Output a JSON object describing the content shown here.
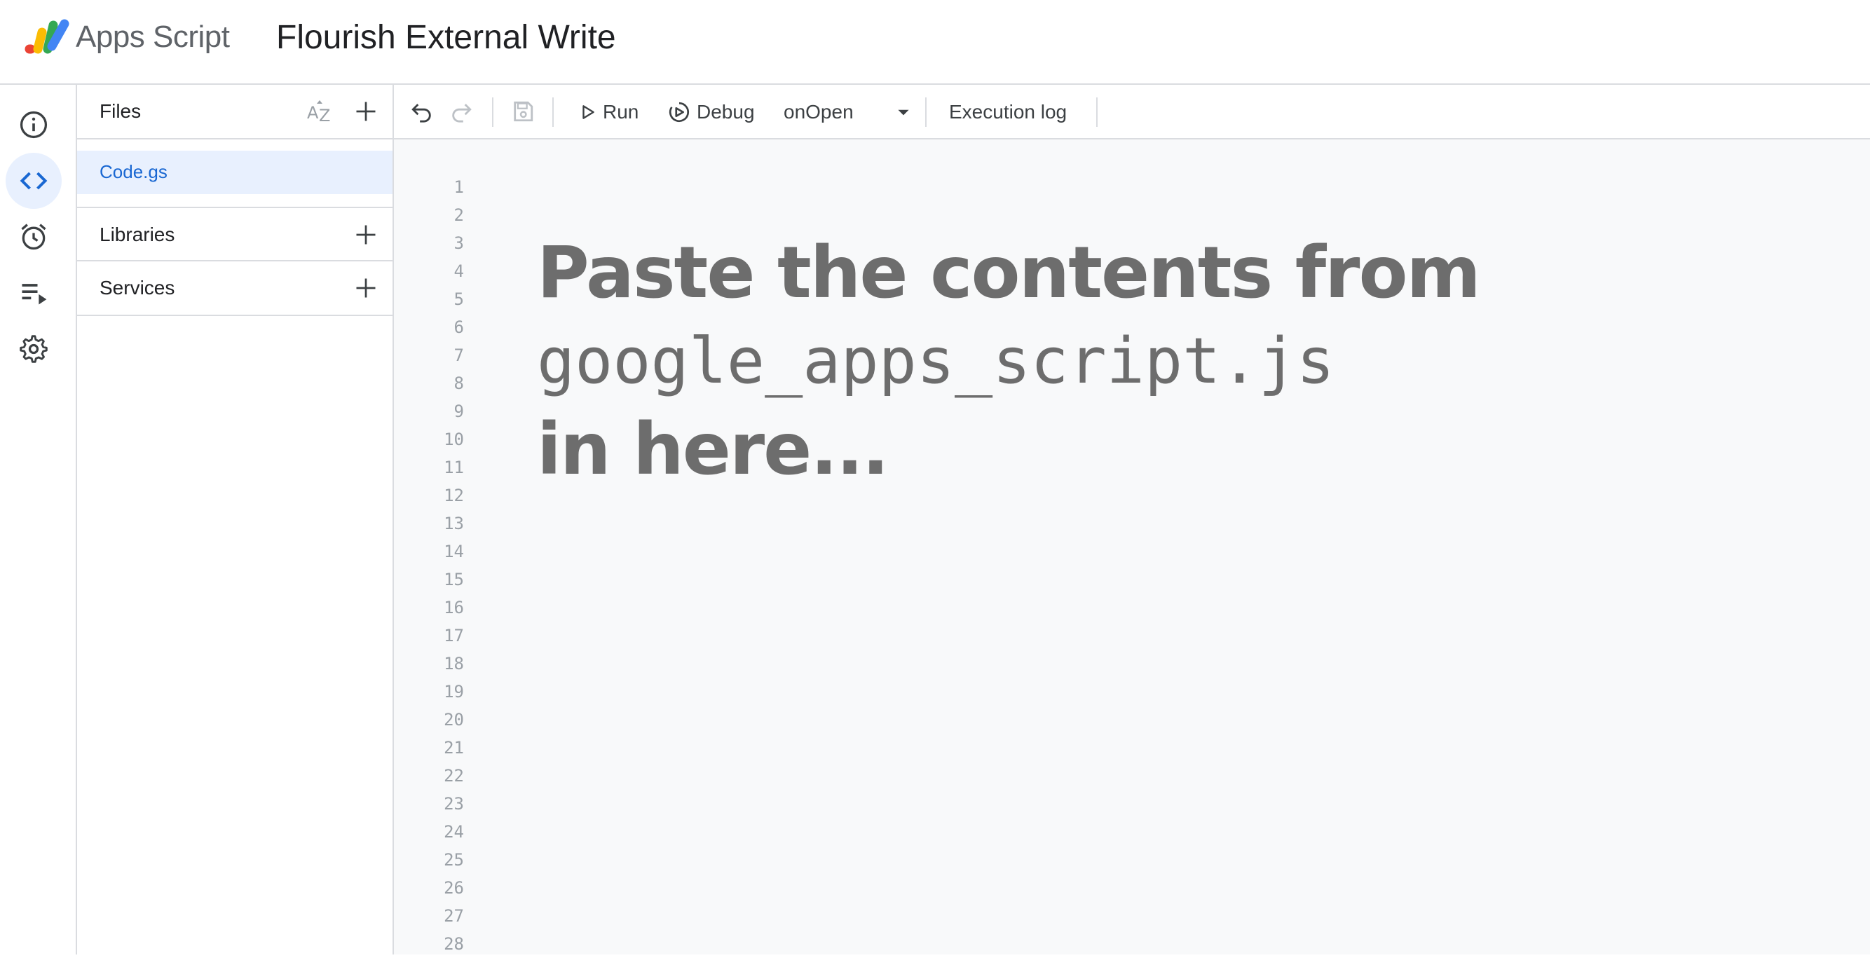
{
  "app": {
    "product_name": "Apps Script",
    "project_title": "Flourish External Write"
  },
  "rail": {
    "items": [
      {
        "name": "overview",
        "icon": "info-icon"
      },
      {
        "name": "editor",
        "icon": "code-icon",
        "active": true
      },
      {
        "name": "triggers",
        "icon": "alarm-clock-icon"
      },
      {
        "name": "executions",
        "icon": "executions-icon"
      },
      {
        "name": "project-settings",
        "icon": "gear-icon"
      }
    ]
  },
  "files_panel": {
    "files_label": "Files",
    "sort_icon": "sort-az-icon",
    "files": [
      {
        "name": "Code.gs",
        "selected": true
      }
    ],
    "libraries_label": "Libraries",
    "services_label": "Services"
  },
  "toolbar": {
    "run_label": "Run",
    "debug_label": "Debug",
    "function_selected": "onOpen",
    "execution_log_label": "Execution log"
  },
  "editor": {
    "line_numbers": [
      "1",
      "2",
      "3",
      "4",
      "5",
      "6",
      "7",
      "8",
      "9",
      "10",
      "11",
      "12",
      "13",
      "14",
      "15",
      "16",
      "17",
      "18",
      "19",
      "20",
      "21",
      "22",
      "23",
      "24",
      "25",
      "26",
      "27",
      "28"
    ],
    "overlay_line1": "Paste the contents from",
    "overlay_line2": "google_apps_script.js",
    "overlay_line3": "in here..."
  },
  "colors": {
    "accent": "#1967d2",
    "selected_bg": "#e8f0fe",
    "border": "#dadce0",
    "editor_bg": "#f8f9fa",
    "overlay_text": "#6d6d6d"
  }
}
